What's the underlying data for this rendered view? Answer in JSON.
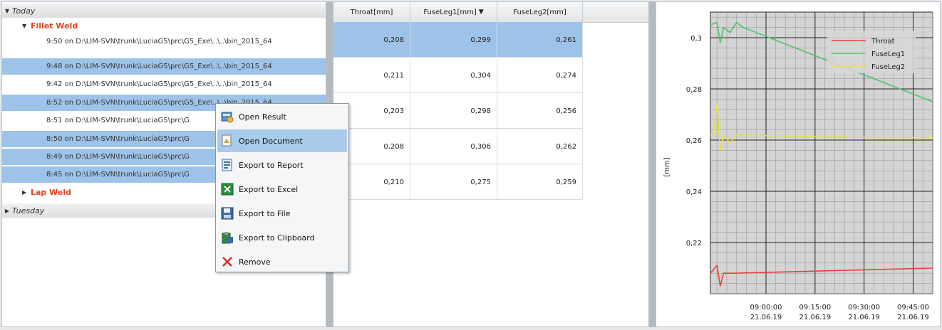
{
  "tree": {
    "groups": [
      {
        "label": "Today",
        "expanded": true
      },
      {
        "label": "Tuesday",
        "expanded": false
      }
    ],
    "subgroups": [
      {
        "label": "Fillet Weld",
        "expanded": true
      },
      {
        "label": "Lap Weld",
        "expanded": false
      }
    ],
    "rows": [
      {
        "label": "9:50 on D:\\LIM-SVN\\trunk\\LuciaG5\\prc\\G5_Exe\\..\\..\\bin_2015_64",
        "selected": false
      },
      {
        "label": "9:48 on D:\\LIM-SVN\\trunk\\LuciaG5\\prc\\G5_Exe\\..\\..\\bin_2015_64",
        "selected": true
      },
      {
        "label": "9:42 on D:\\LIM-SVN\\trunk\\LuciaG5\\prc\\G5_Exe\\..\\..\\bin_2015_64",
        "selected": false
      },
      {
        "label": "8:52 on D:\\LIM-SVN\\trunk\\LuciaG5\\prc\\G5_Exe\\..\\..\\bin_2015_64",
        "selected": true
      },
      {
        "label": "8:51 on D:\\LIM-SVN\\trunk\\LuciaG5\\prc\\G",
        "selected": false
      },
      {
        "label": "8:50 on D:\\LIM-SVN\\trunk\\LuciaG5\\prc\\G",
        "selected": true
      },
      {
        "label": "8:49 on D:\\LIM-SVN\\trunk\\LuciaG5\\prc\\G",
        "selected": true
      },
      {
        "label": "8:45 on D:\\LIM-SVN\\trunk\\LuciaG5\\prc\\G",
        "selected": true
      }
    ]
  },
  "grid": {
    "headers": [
      "Throat[mm]",
      "FuseLeg1[mm]",
      "FuseLeg2[mm]"
    ],
    "sort_indicator": "▼",
    "rows": [
      {
        "cells": [
          "0,208",
          "0,299",
          "0,261"
        ],
        "selected": true
      },
      {
        "cells": [
          "0,211",
          "0,304",
          "0,274"
        ],
        "selected": false
      },
      {
        "cells": [
          "0,203",
          "0,298",
          "0,256"
        ],
        "selected": false
      },
      {
        "cells": [
          "0,208",
          "0,306",
          "0,262"
        ],
        "selected": false
      },
      {
        "cells": [
          "0,210",
          "0,275",
          "0,259"
        ],
        "selected": false
      }
    ]
  },
  "context_menu": {
    "items": [
      {
        "label": "Open Result",
        "icon": "open-result-icon",
        "highlighted": false
      },
      {
        "label": "Open Document",
        "icon": "open-document-icon",
        "highlighted": true
      },
      {
        "label": "Export to Report",
        "icon": "report-icon",
        "highlighted": false
      },
      {
        "label": "Export to Excel",
        "icon": "excel-icon",
        "highlighted": false
      },
      {
        "label": "Export to File",
        "icon": "save-file-icon",
        "highlighted": false
      },
      {
        "label": "Export to Clipboard",
        "icon": "clipboard-icon",
        "highlighted": false
      },
      {
        "label": "Remove",
        "icon": "remove-icon",
        "highlighted": false
      }
    ]
  },
  "colors": {
    "selection": "#9ec3e8",
    "subgroup_text": "#e0421f",
    "throat": "#e8413a",
    "fuseleg1": "#4fc06a",
    "fuseleg2": "#e6e23a",
    "plot_background": "#d4d4d4"
  },
  "chart_data": {
    "type": "line",
    "title": "",
    "xlabel": "",
    "ylabel": "[mm]",
    "ylim": [
      0.2,
      0.31
    ],
    "yticks": [
      "0,22",
      "0,24",
      "0,26",
      "0,28",
      "0,3"
    ],
    "xticks": [
      {
        "time": "09:00:00",
        "date": "21.06.19"
      },
      {
        "time": "09:15:00",
        "date": "21.06.19"
      },
      {
        "time": "09:30:00",
        "date": "21.06.19"
      },
      {
        "time": "09:45:00",
        "date": "21.06.19"
      }
    ],
    "xrange": [
      "08:43",
      "09:51"
    ],
    "grid": true,
    "legend_position": "top-right",
    "series": [
      {
        "name": "Throat",
        "color": "#e8413a",
        "points": [
          [
            "08:43",
            0.208
          ],
          [
            "08:45",
            0.211
          ],
          [
            "08:46",
            0.203
          ],
          [
            "08:47",
            0.208
          ],
          [
            "08:50",
            0.208
          ],
          [
            "09:20",
            0.209
          ],
          [
            "09:51",
            0.21
          ]
        ]
      },
      {
        "name": "FuseLeg1",
        "color": "#4fc06a",
        "points": [
          [
            "08:43",
            0.305
          ],
          [
            "08:45",
            0.306
          ],
          [
            "08:46",
            0.298
          ],
          [
            "08:47",
            0.304
          ],
          [
            "08:49",
            0.302
          ],
          [
            "08:51",
            0.306
          ],
          [
            "08:53",
            0.304
          ],
          [
            "09:51",
            0.275
          ]
        ]
      },
      {
        "name": "FuseLeg2",
        "color": "#e6e23a",
        "points": [
          [
            "08:43",
            0.262
          ],
          [
            "08:44",
            0.262
          ],
          [
            "08:45",
            0.274
          ],
          [
            "08:46",
            0.256
          ],
          [
            "08:47",
            0.262
          ],
          [
            "08:49",
            0.259
          ],
          [
            "08:51",
            0.262
          ],
          [
            "09:30",
            0.261
          ],
          [
            "09:51",
            0.261
          ]
        ]
      }
    ]
  }
}
